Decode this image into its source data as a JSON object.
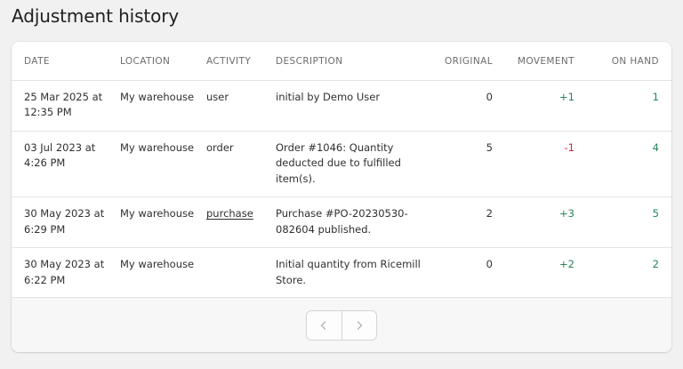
{
  "page": {
    "title": "Adjustment history"
  },
  "table": {
    "columns": {
      "date": "DATE",
      "location": "LOCATION",
      "activity": "ACTIVITY",
      "description": "DESCRIPTION",
      "original": "ORIGINAL",
      "movement": "MOVEMENT",
      "on_hand": "ON HAND"
    },
    "rows": [
      {
        "date": "25 Mar 2025 at 12:35 PM",
        "location": "My warehouse",
        "activity": "user",
        "description": "initial by Demo User",
        "original": "0",
        "movement": "+1",
        "on_hand": "1"
      },
      {
        "date": "03 Jul 2023 at 4:26 PM",
        "location": "My warehouse",
        "activity": "order",
        "description": "Order #1046: Quantity deducted due to fulfilled item(s).",
        "original": "5",
        "movement": "-1",
        "on_hand": "4"
      },
      {
        "date": "30 May 2023 at 6:29 PM",
        "location": "My warehouse",
        "activity": "purchase",
        "description": "Purchase #PO-20230530-082604 published.",
        "original": "2",
        "movement": "+3",
        "on_hand": "5"
      },
      {
        "date": "30 May 2023 at 6:22 PM",
        "location": "My warehouse",
        "activity": "",
        "description": "Initial quantity from Ricemill Store.",
        "original": "0",
        "movement": "+2",
        "on_hand": "2"
      }
    ]
  },
  "pagination": {
    "prev_icon": "chevron-left-icon",
    "next_icon": "chevron-right-icon"
  },
  "colors": {
    "positive": "#29845a",
    "negative": "#c5283d",
    "background": "#f1f1f1"
  }
}
